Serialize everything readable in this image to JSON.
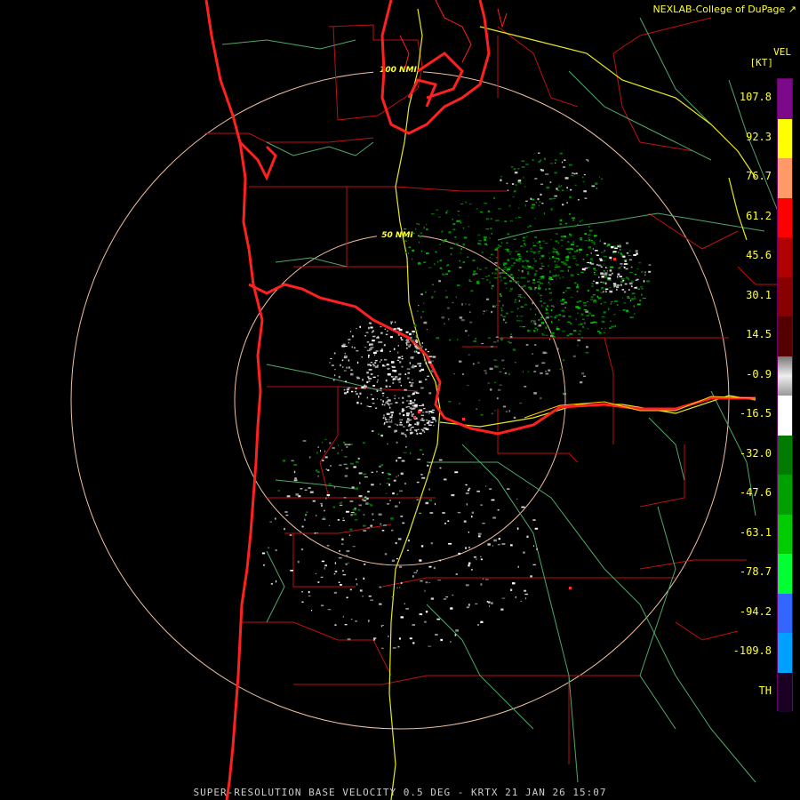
{
  "credit": "NEXLAB-College of DuPage ↗",
  "product": "VEL",
  "units": "[KT]",
  "rings": [
    "100 NMI",
    "50 NMI"
  ],
  "legend": {
    "labels": [
      "107.8",
      "92.3",
      "76.7",
      "61.2",
      "45.6",
      "30.1",
      "14.5",
      "-0.9",
      "-16.5",
      "-32.0",
      "-47.6",
      "-63.1",
      "-78.7",
      "-94.2",
      "-109.8",
      "TH"
    ],
    "colors": [
      "#7a0a8a",
      "#ffff00",
      "#ff9966",
      "#ff0000",
      "#b00000",
      "#880000",
      "#550000",
      "#999999",
      "#ffffff",
      "#007a00",
      "#00a000",
      "#00cc00",
      "#00ff33",
      "#3366ff",
      "#00a0ff",
      "#1a0022"
    ]
  },
  "caption": "SUPER-RESOLUTION BASE VELOCITY 0.5 DEG - KRTX 21 JAN 26 15:07"
}
